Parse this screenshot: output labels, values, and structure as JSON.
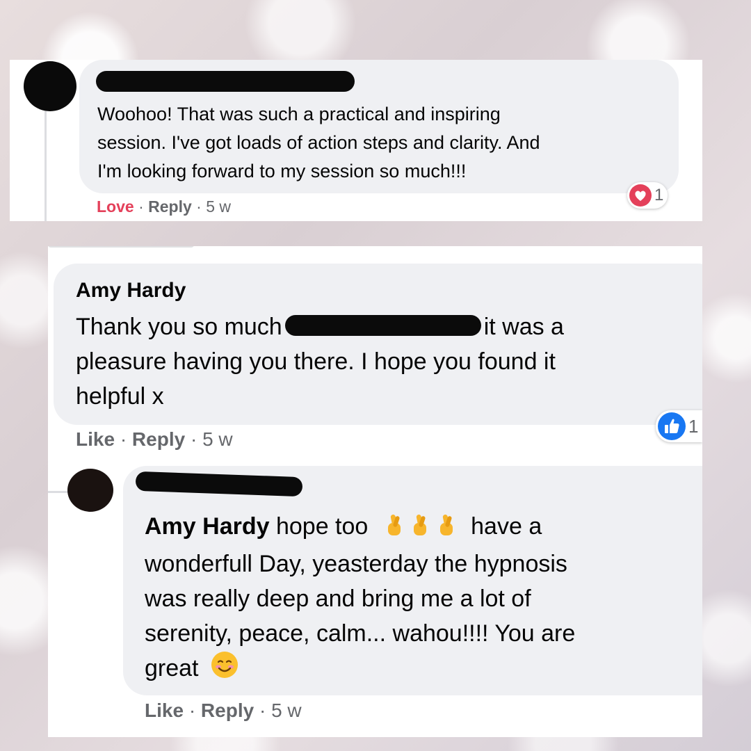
{
  "comment1": {
    "text": "Woohoo! That was such a practical and inspiring session. I've got loads of action steps and clarity. And I'm looking forward to my session so much!!!",
    "line1": "Woohoo! That was such a practical and inspiring",
    "line2": "session. I've got loads of action steps and clarity. And",
    "line3": "I'm looking forward to my session so much!!!",
    "actions": {
      "reaction": "Love",
      "reply": "Reply",
      "time": "5 w"
    },
    "reaction_count": "1",
    "reaction_icon": "heart-icon"
  },
  "comment2": {
    "author": "Amy Hardy",
    "line1_before": "Thank you so much",
    "line1_after": "it was a",
    "line2": "pleasure having you there. I hope you found it",
    "line3": "helpful x",
    "actions": {
      "reaction": "Like",
      "reply": "Reply",
      "time": "5 w"
    },
    "reaction_count": "1",
    "reaction_icon": "thumbs-up-icon"
  },
  "comment3": {
    "mention": "Amy Hardy",
    "line1_a": "hope too",
    "line1_b": "have a",
    "line2": "wonderfull Day, yeasterday the hypnosis",
    "line3": "was really deep and bring me a lot of",
    "line4": "serenity, peace, calm... wahou!!!! You are",
    "line5": "great",
    "emojis": [
      "crossed-fingers",
      "crossed-fingers",
      "crossed-fingers",
      "smiling-face"
    ],
    "actions": {
      "reaction": "Like",
      "reply": "Reply",
      "time": "5 w"
    }
  },
  "colors": {
    "bubble": "#eff0f3",
    "love": "#e4405a",
    "like_blue": "#1877f2",
    "meta": "#65676b"
  }
}
